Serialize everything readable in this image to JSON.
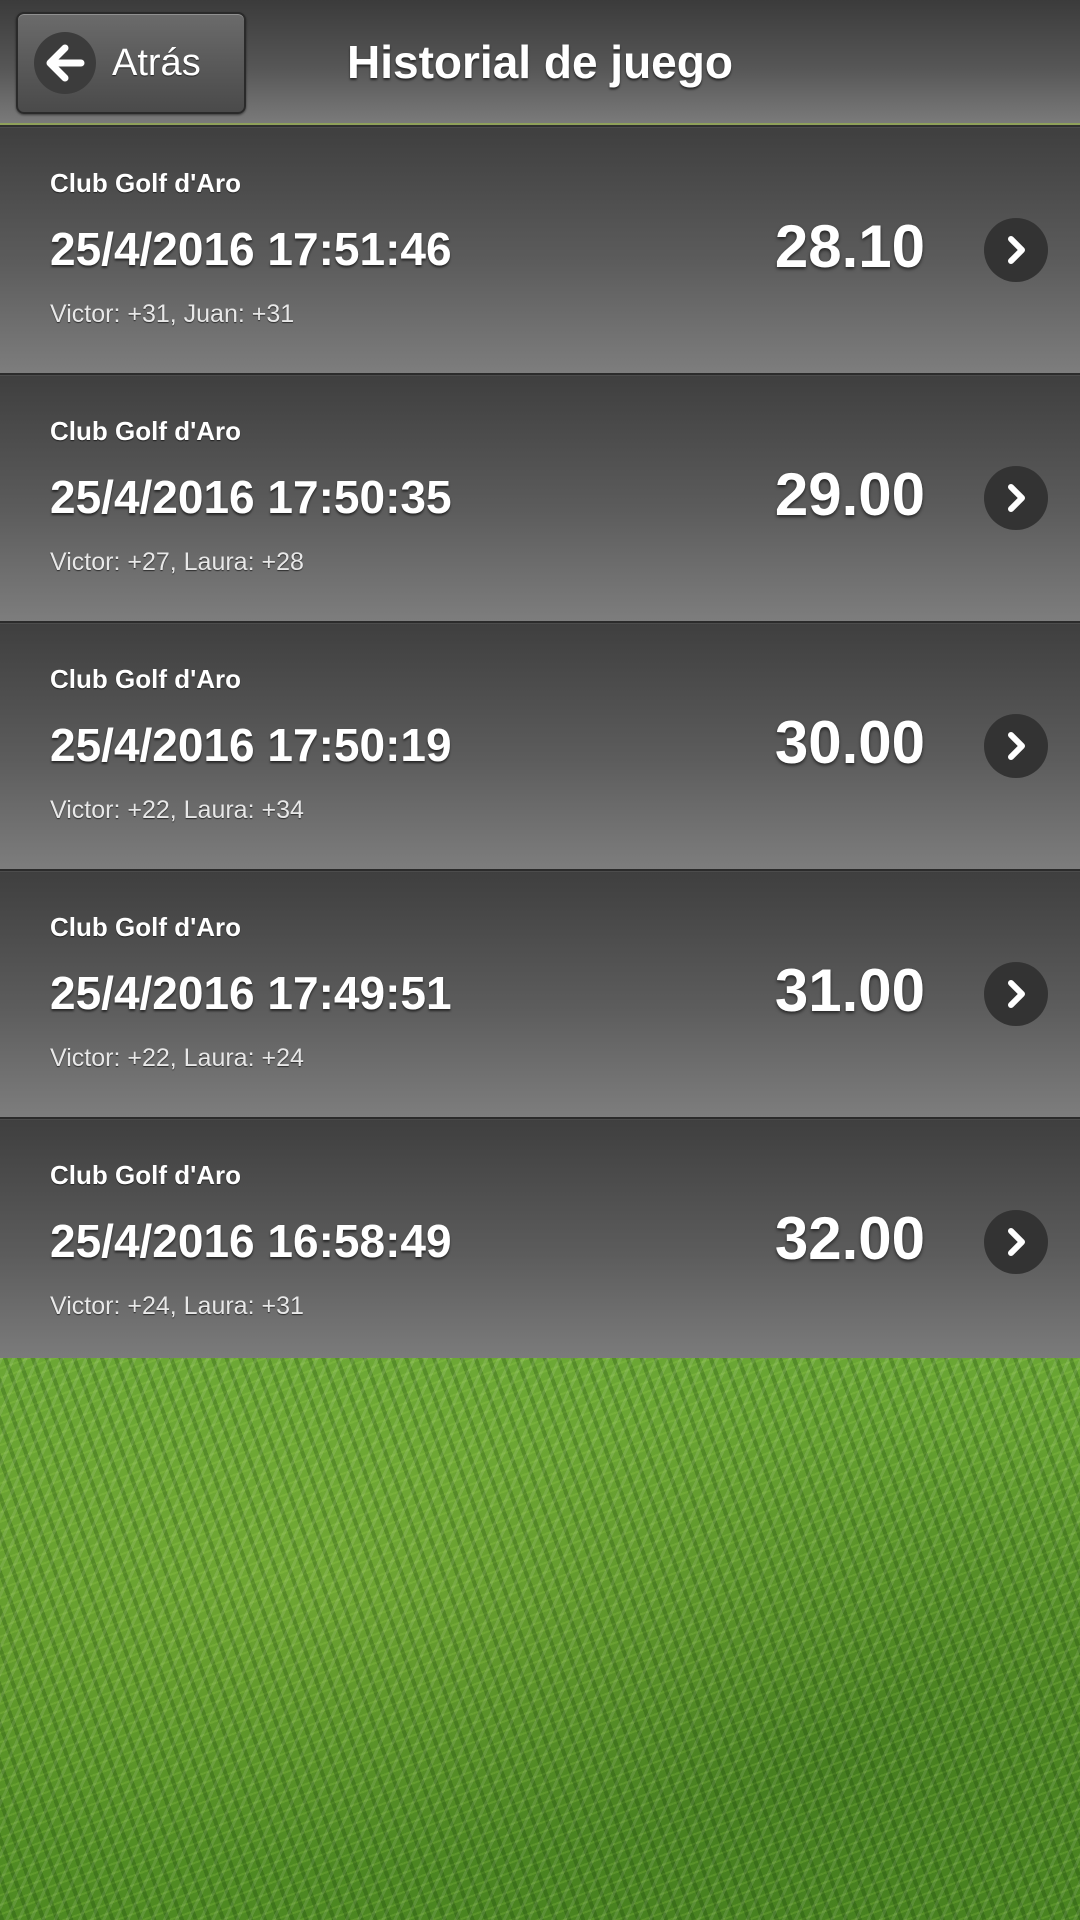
{
  "header": {
    "back_label": "Atrás",
    "title": "Historial de juego"
  },
  "games": [
    {
      "club": "Club Golf d'Aro",
      "date": "25/4/2016 17:51:46",
      "players": "Victor: +31, Juan: +31",
      "score": "28.10"
    },
    {
      "club": "Club Golf d'Aro",
      "date": "25/4/2016 17:50:35",
      "players": "Victor: +27, Laura: +28",
      "score": "29.00"
    },
    {
      "club": "Club Golf d'Aro",
      "date": "25/4/2016 17:50:19",
      "players": "Victor: +22, Laura: +34",
      "score": "30.00"
    },
    {
      "club": "Club Golf d'Aro",
      "date": "25/4/2016 17:49:51",
      "players": "Victor: +22, Laura: +24",
      "score": "31.00"
    },
    {
      "club": "Club Golf d'Aro",
      "date": "25/4/2016 16:58:49",
      "players": "Victor: +24, Laura: +31",
      "score": "32.00"
    }
  ],
  "icons": {
    "back": "arrow-left-icon",
    "row_action": "chevron-right-icon"
  },
  "colors": {
    "header_accent": "#8fa05a",
    "grass": "#5e9a2a"
  }
}
